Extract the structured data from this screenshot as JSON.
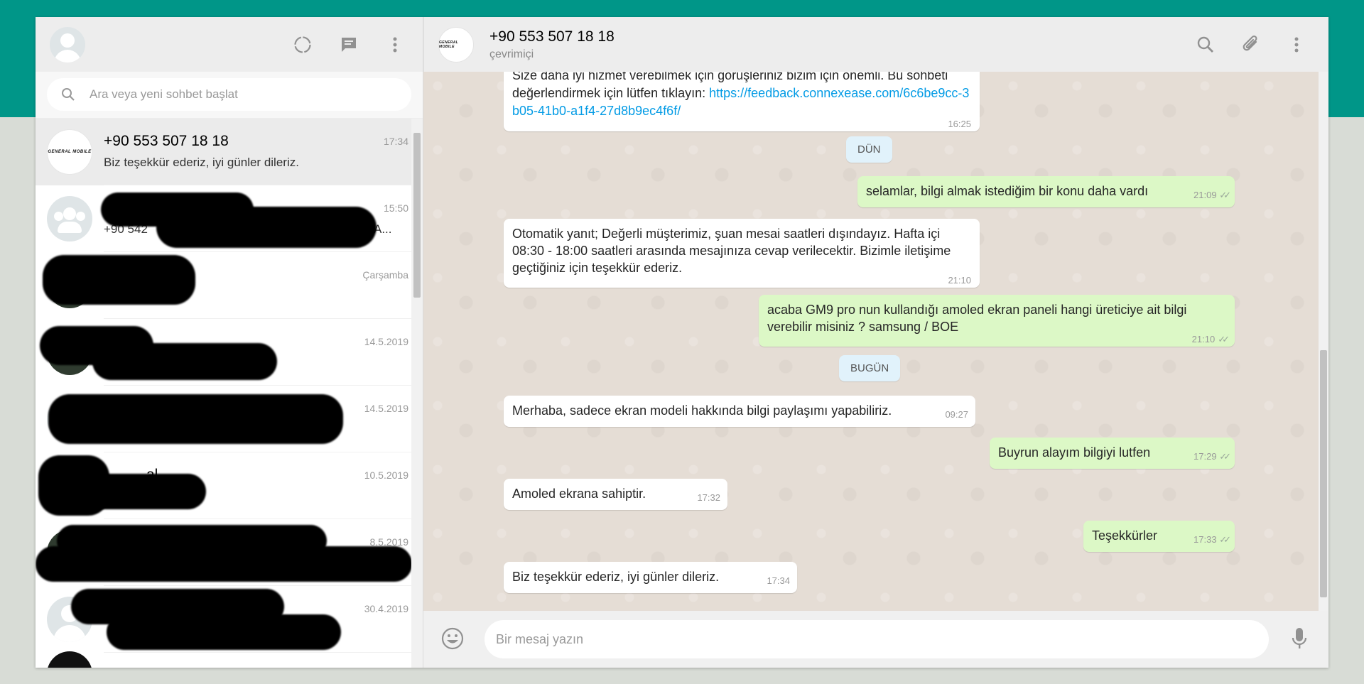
{
  "sidebar": {
    "search_placeholder": "Ara veya yeni sohbet başlat",
    "chats": [
      {
        "name": "+90 553 507 18 18",
        "time": "17:34",
        "preview": "Biz teşekkür ederiz, iyi günler dileriz."
      },
      {
        "name": "",
        "time": "15:50",
        "preview": "+90 542",
        "preview_tail": "A..."
      },
      {
        "name": "",
        "time": "Çarşamba",
        "preview": ""
      },
      {
        "name": "",
        "time": "14.5.2019",
        "preview": ""
      },
      {
        "name": "",
        "time": "14.5.2019",
        "preview": ""
      },
      {
        "name": "al",
        "time": "10.5.2019",
        "preview": ""
      },
      {
        "name": "",
        "time": "8.5.2019",
        "preview": ""
      },
      {
        "name": "",
        "time": "30.4.2019",
        "preview": ""
      }
    ]
  },
  "header": {
    "contact_name": "+90 553 507 18 18",
    "status": "çevrimiçi",
    "avatar_text": "GENERAL MOBILE"
  },
  "conversation": {
    "msg1_text": "Size daha iyi hizmet verebilmek için görüşleriniz bizim için önemli. Bu sohbeti değerlendirmek için lütfen tıklayın: ",
    "msg1_link": "https://feedback.connexease.com/6c6be9cc-3b05-41b0-a1f4-27d8b9ec4f6f/",
    "msg1_time": "16:25",
    "date_yesterday": "DÜN",
    "msg2_text": "selamlar, bilgi almak istediğim bir konu daha vardı",
    "msg2_time": "21:09",
    "msg3_text": "Otomatik yanıt; Değerli müşterimiz, şuan mesai saatleri dışındayız. Hafta içi 08:30 - 18:00 saatleri arasında mesajınıza cevap verilecektir. Bizimle iletişime geçtiğiniz için teşekkür ederiz.",
    "msg3_time": "21:10",
    "msg4_text": "acaba GM9 pro nun kullandığı amoled ekran paneli hangi üreticiye ait bilgi verebilir misiniz ? samsung / BOE",
    "msg4_time": "21:10",
    "date_today": "BUGÜN",
    "msg5_text": "Merhaba, sadece ekran modeli hakkında bilgi paylaşımı yapabiliriz.",
    "msg5_time": "09:27",
    "msg6_text": "Buyrun alayım bilgiyi lutfen",
    "msg6_time": "17:29",
    "msg7_text": "Amoled ekrana sahiptir.",
    "msg7_time": "17:32",
    "msg8_text": "Teşekkürler",
    "msg8_time": "17:33",
    "msg9_text": "Biz teşekkür ederiz, iyi günler dileriz.",
    "msg9_time": "17:34"
  },
  "composer": {
    "placeholder": "Bir mesaj yazın"
  },
  "colors": {
    "teal": "#009688",
    "outgoing": "#dcf8c6",
    "incoming": "#ffffff",
    "link": "#039be5",
    "date_chip": "#e1f2fb"
  }
}
